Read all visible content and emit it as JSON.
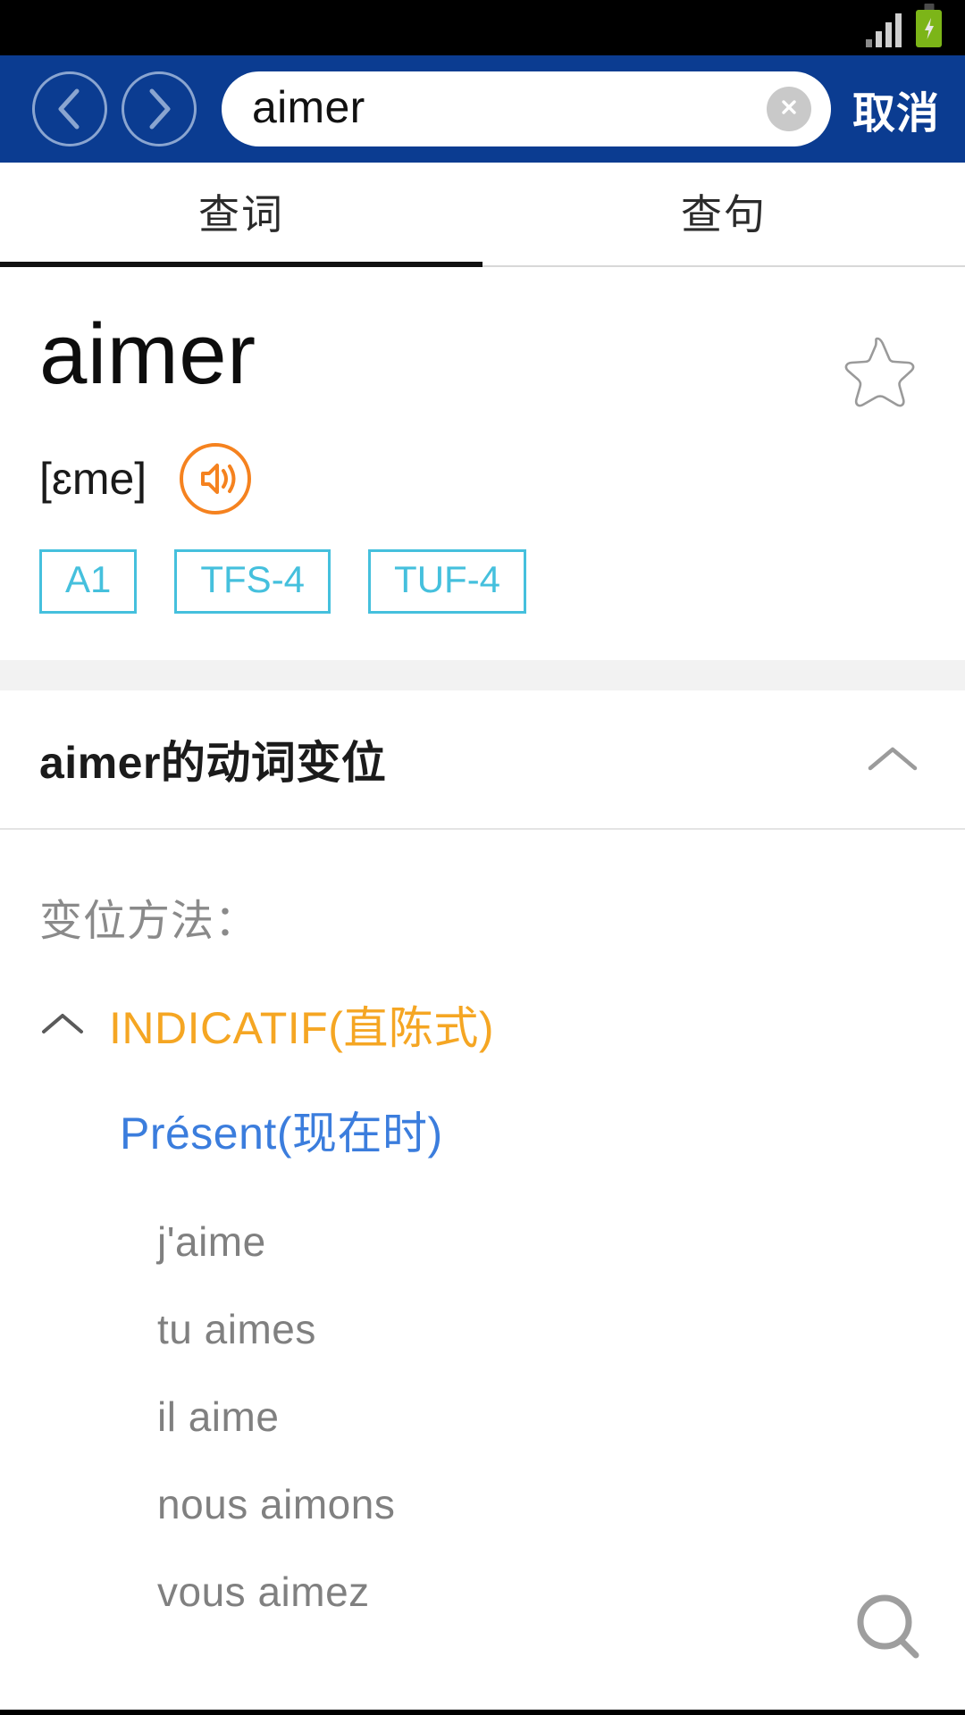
{
  "status_bar": {
    "signal_icon": "signal-bars-icon",
    "signal_bars": 4,
    "battery_icon": "battery-charging-icon",
    "battery_color": "#7cb518"
  },
  "header": {
    "background_color": "#0b3c91",
    "back_icon": "chevron-left-circle-icon",
    "forward_icon": "chevron-right-circle-icon",
    "search": {
      "value": "aimer",
      "placeholder": "",
      "clear_icon": "clear-circle-icon"
    },
    "cancel_label": "取消"
  },
  "tabs": [
    {
      "label": "查词",
      "active": true
    },
    {
      "label": "查句",
      "active": false
    }
  ],
  "entry": {
    "headword": "aimer",
    "favorite_icon": "star-outline-icon",
    "phonetic": "[ɛme]",
    "speaker_icon": "speaker-circle-icon",
    "speaker_color": "#f5821f",
    "chips": [
      {
        "label": "A1"
      },
      {
        "label": "TFS-4"
      },
      {
        "label": "TUF-4"
      }
    ],
    "chip_color": "#45c0dd"
  },
  "conjugation_section": {
    "title": "aimer的动词变位",
    "collapse_icon": "chevron-up-icon",
    "method_label": "变位方法：",
    "mood": {
      "label": "INDICATIF(直陈式)",
      "color": "#f5a623",
      "toggle_icon": "chevron-up-icon"
    },
    "tense": {
      "label": "Présent(现在时)",
      "color": "#3b7ddd"
    },
    "forms": [
      "j'aime",
      "tu aimes",
      "il aime",
      "nous aimons",
      "vous aimez"
    ]
  },
  "fab": {
    "search_icon": "search-icon"
  }
}
